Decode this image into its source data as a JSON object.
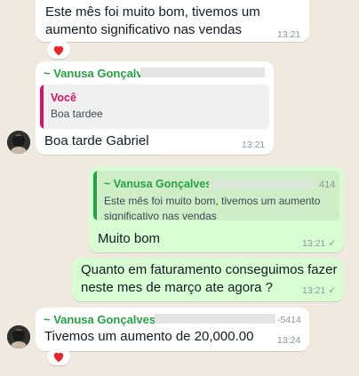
{
  "messages": [
    {
      "text": "Este mês  foi muito  bom, tivemos  um\naumento significativo  nas vendas",
      "time": "13:21",
      "reaction": "heart-icon"
    },
    {
      "sender": "~ Vanusa Gonçalv",
      "quote": {
        "author": "Você",
        "text": "Boa tardee"
      },
      "text": "Boa tarde  Gabriel",
      "time": "13:21"
    },
    {
      "quote": {
        "author": "~ Vanusa Gonçalves",
        "author_suffix": "414",
        "text": "Este mês  foi muito  bom, tivemos  um aumento\nsignificativo  nas vendas"
      },
      "text": "Muito bom",
      "time": "13:21",
      "status": "✓"
    },
    {
      "text": "Quanto em faturamento conseguimos fazer\nneste mes de março ate agora ?",
      "time": "13:21",
      "status": "✓"
    },
    {
      "sender": "~ Vanusa Gonçalves",
      "sender_suffix": "-5414",
      "text": "Tivemos  um aumento  de  20,000.00",
      "time": "13:24",
      "reaction": "heart-icon"
    }
  ],
  "colors": {
    "background": "#efe9e0",
    "incoming_bubble": "#ffffff",
    "outgoing_bubble": "#d9fdd3",
    "sender_name": "#25a244",
    "quote_you": "#d4136d",
    "quote_other": "#25a244",
    "heart": "#e8252e"
  }
}
